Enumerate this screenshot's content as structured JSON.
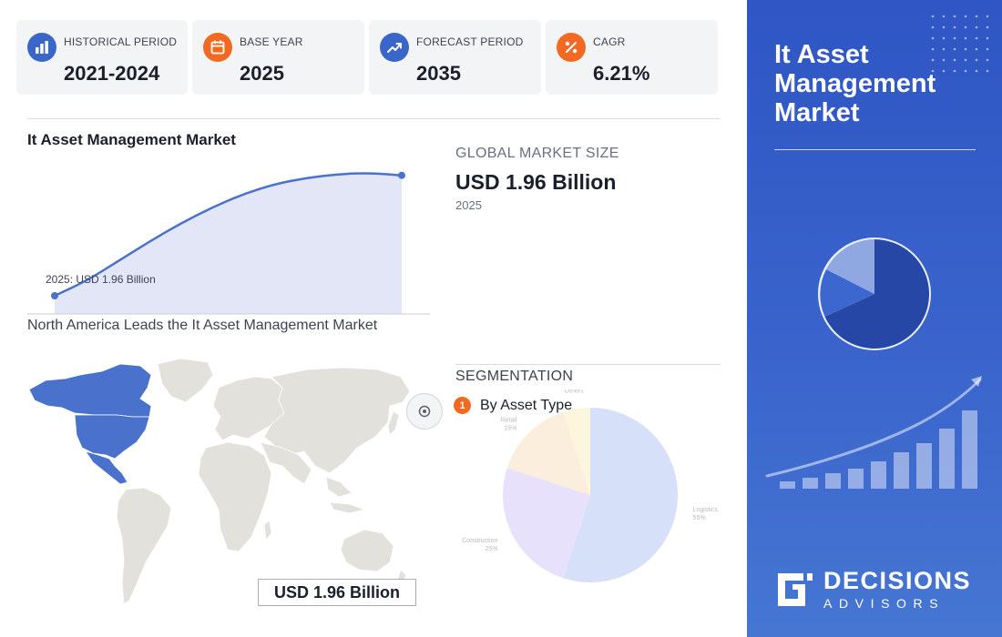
{
  "stats": [
    {
      "label": "HISTORICAL PERIOD",
      "value": "2021-2024",
      "icon": "bar-chart-icon",
      "color": "#3b66c9"
    },
    {
      "label": "BASE YEAR",
      "value": "2025",
      "icon": "calendar-icon",
      "color": "#f26a22"
    },
    {
      "label": "FORECAST PERIOD",
      "value": "2035",
      "icon": "trend-up-icon",
      "color": "#3b66c9"
    },
    {
      "label": "CAGR",
      "value": "6.21%",
      "icon": "percent-icon",
      "color": "#f26a22"
    }
  ],
  "market_chart": {
    "title": "It Asset Management Market",
    "annotation": "2025: USD 1.96 Billion"
  },
  "chart_data": {
    "type": "area",
    "title": "It Asset Management Market",
    "xlabel": "",
    "ylabel": "",
    "grid": false,
    "annotations": [
      "2025: USD 1.96 Billion"
    ],
    "series": [
      {
        "values": [
          0.0,
          0.12,
          0.28,
          0.44,
          0.59,
          0.72,
          0.83,
          0.91,
          0.96,
          0.99,
          1.0,
          0.98
        ]
      }
    ]
  },
  "map_section": {
    "title": "North America Leads the It Asset Management Market",
    "value": "USD 1.96 Billion"
  },
  "market_size": {
    "label": "GLOBAL MARKET SIZE",
    "value": "USD 1.96 Billion",
    "year": "2025"
  },
  "segmentation": {
    "label": "SEGMENTATION",
    "items": [
      {
        "number": "1",
        "label": "By Asset Type"
      }
    ],
    "pie": [
      {
        "name": "Logistics",
        "pct": "55%",
        "value": 55,
        "color": "#d6e1f9"
      },
      {
        "name": "Construction",
        "pct": "25%",
        "value": 25,
        "color": "#e7e1fb"
      },
      {
        "name": "Retail",
        "pct": "15%",
        "value": 15,
        "color": "#fbeedd"
      },
      {
        "name": "Others",
        "pct": "",
        "value": 5,
        "color": "#fdf6dd"
      }
    ]
  },
  "panel": {
    "title": "It Asset Management Market",
    "logo_main": "DECISIONS",
    "logo_sub": "ADVISORS"
  }
}
